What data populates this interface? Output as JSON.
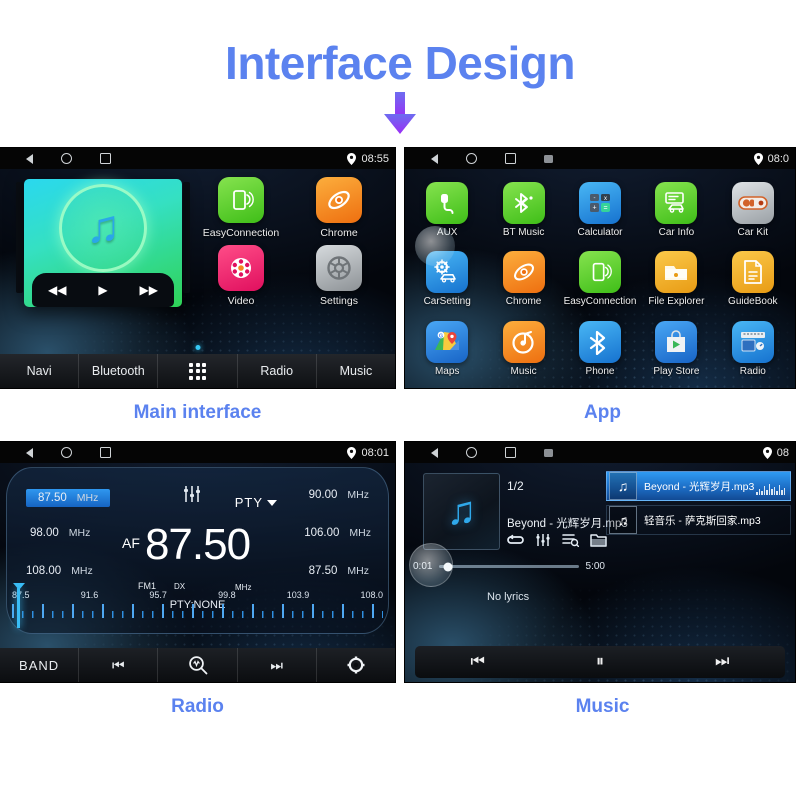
{
  "header": {
    "title": "Interface Design",
    "title_color": "#5b82ef",
    "arrow_color": "#8a3df0",
    "arrow_icon": "arrow-down-icon"
  },
  "panels": [
    {
      "id": "main-interface",
      "caption": "Main interface",
      "statusbar": {
        "back_icon": "back-triangle-icon",
        "home_icon": "home-circle-icon",
        "recents_icon": "recents-square-icon",
        "location_icon": "location-pin-icon",
        "time": "08:55"
      },
      "widget": {
        "name": "music-widget",
        "note_icon": "music-note-icon",
        "prev_icon": "rewind-icon",
        "play_icon": "play-icon",
        "next_icon": "fast-forward-icon"
      },
      "apps": [
        {
          "label": "EasyConnection",
          "icon": "phone-cast-icon",
          "color": "#5ed133"
        },
        {
          "label": "Chrome",
          "icon": "swirl-icon",
          "color": "#f5891f"
        },
        {
          "label": "Video",
          "icon": "film-reel-icon",
          "color": "#ef2b73"
        },
        {
          "label": "Settings",
          "icon": "gear-icon",
          "color": "#a8adb2"
        }
      ],
      "bottom_nav": [
        {
          "label": "Navi",
          "icon": ""
        },
        {
          "label": "Bluetooth",
          "icon": ""
        },
        {
          "label": "",
          "icon": "app-grid-icon"
        },
        {
          "label": "Radio",
          "icon": ""
        },
        {
          "label": "Music",
          "icon": ""
        }
      ]
    },
    {
      "id": "app",
      "caption": "App",
      "statusbar": {
        "back_icon": "back-triangle-icon",
        "home_icon": "home-circle-icon",
        "recents_icon": "recents-square-icon",
        "screenshot_icon": "screenshot-icon",
        "location_icon": "location-pin-icon",
        "time": "08:0"
      },
      "apps": [
        {
          "label": "AUX",
          "icon": "aux-plug-icon",
          "color": "#5ed133"
        },
        {
          "label": "BT Music",
          "icon": "bluetooth-note-icon",
          "color": "#5ed133"
        },
        {
          "label": "Calculator",
          "icon": "calculator-icon",
          "color": "#2a9bea"
        },
        {
          "label": "Car Info",
          "icon": "car-info-icon",
          "color": "#5ed133"
        },
        {
          "label": "Car Kit",
          "icon": "car-kit-toggle-icon",
          "color": "#b9bec2"
        },
        {
          "label": "CarSetting",
          "icon": "car-gear-icon",
          "color": "#2a9bea"
        },
        {
          "label": "Chrome",
          "icon": "swirl-icon",
          "color": "#f5891f"
        },
        {
          "label": "EasyConnection",
          "icon": "phone-cast-icon",
          "color": "#5ed133"
        },
        {
          "label": "File Explorer",
          "icon": "folder-icon",
          "color": "#f3ab23"
        },
        {
          "label": "GuideBook",
          "icon": "document-icon",
          "color": "#f3ab23"
        },
        {
          "label": "Maps",
          "icon": "maps-pin-icon",
          "color": "#2a7bea"
        },
        {
          "label": "Music",
          "icon": "vinyl-note-icon",
          "color": "#f5891f"
        },
        {
          "label": "Phone",
          "icon": "bluetooth-icon",
          "color": "#2a9bea"
        },
        {
          "label": "Play Store",
          "icon": "play-store-bag-icon",
          "color": "#2a9bea"
        },
        {
          "label": "Radio",
          "icon": "radio-set-icon",
          "color": "#2a9bea"
        }
      ]
    },
    {
      "id": "radio",
      "caption": "Radio",
      "statusbar": {
        "back_icon": "back-triangle-icon",
        "home_icon": "home-circle-icon",
        "recents_icon": "recents-square-icon",
        "location_icon": "location-pin-icon",
        "time": "08:01"
      },
      "eq_icon": "equalizer-icon",
      "pty_label": "PTY",
      "pty_caret_icon": "chevron-down-icon",
      "presets_left": [
        {
          "freq": "87.50",
          "unit": "MHz",
          "selected": true
        },
        {
          "freq": "98.00",
          "unit": "MHz",
          "selected": false
        },
        {
          "freq": "108.00",
          "unit": "MHz",
          "selected": false
        }
      ],
      "presets_right": [
        {
          "freq": "90.00",
          "unit": "MHz",
          "selected": false
        },
        {
          "freq": "106.00",
          "unit": "MHz",
          "selected": false
        },
        {
          "freq": "87.50",
          "unit": "MHz",
          "selected": false
        }
      ],
      "af_label": "AF",
      "current_freq": "87.50",
      "band_label": "FM1",
      "dx_label": "DX",
      "unit_small": "MHz",
      "pty_status": "PTY:NONE",
      "scale_labels": [
        "87.5",
        "91.6",
        "95.7",
        "99.8",
        "103.9",
        "108.0"
      ],
      "scale_min": 87.5,
      "scale_max": 108.0,
      "cursor_freq": 87.5,
      "bottom_nav": [
        {
          "label": "BAND",
          "icon": "band-button"
        },
        {
          "label": "",
          "icon": "skip-previous-icon"
        },
        {
          "label": "",
          "icon": "scan-search-icon"
        },
        {
          "label": "",
          "icon": "skip-next-icon"
        },
        {
          "label": "",
          "icon": "gear-icon"
        }
      ]
    },
    {
      "id": "music",
      "caption": "Music",
      "statusbar": {
        "back_icon": "back-triangle-icon",
        "home_icon": "home-circle-icon",
        "recents_icon": "recents-square-icon",
        "screenshot_icon": "screenshot-icon",
        "location_icon": "location-pin-icon",
        "time": "08"
      },
      "album_icon": "music-note-icon",
      "track_index": "1/2",
      "track_name": "Beyond - 光辉岁月.mp3",
      "control_icons": [
        "repeat-icon",
        "equalizer-icon",
        "playlist-search-icon",
        "folder-icon"
      ],
      "time_elapsed": "0:01",
      "time_total": "5:00",
      "progress_percent": 6,
      "lyrics_status": "No lyrics",
      "playlist": [
        {
          "name": "Beyond - 光辉岁月.mp3",
          "icon": "music-note-icon",
          "selected": true
        },
        {
          "name": "轻音乐 - 萨克斯回家.mp3",
          "icon": "music-note-icon",
          "selected": false
        }
      ],
      "bottom_nav": [
        {
          "label": "",
          "icon": "skip-previous-icon"
        },
        {
          "label": "",
          "icon": "pause-icon"
        },
        {
          "label": "",
          "icon": "skip-next-icon"
        }
      ]
    }
  ]
}
